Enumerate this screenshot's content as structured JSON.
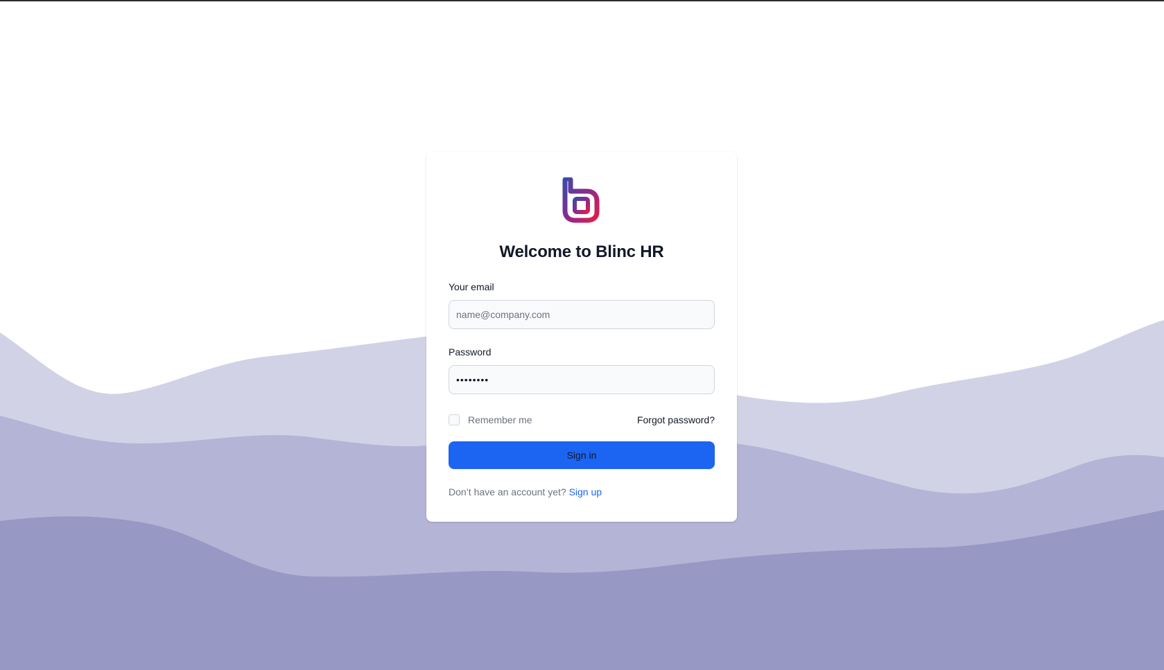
{
  "brand": {
    "name": "Blinc HR",
    "logo_icon": "blinc-logo-icon",
    "logo_gradient": [
      "#3b4aa8",
      "#8b2a8f",
      "#e11d48"
    ]
  },
  "login": {
    "title": "Welcome to Blinc HR",
    "email_label": "Your email",
    "email_placeholder": "name@company.com",
    "email_value": "",
    "password_label": "Password",
    "password_value": "••••••••",
    "remember_label": "Remember me",
    "remember_checked": false,
    "forgot_label": "Forgot password?",
    "submit_label": "Sign in",
    "signup_prompt": "Don’t have an account yet?",
    "signup_link": "Sign up"
  },
  "theme": {
    "primary": "#1c64f2",
    "wave_light": "#d1d2e6",
    "wave_mid": "#b4b4d6",
    "wave_dark": "#9898c5"
  }
}
